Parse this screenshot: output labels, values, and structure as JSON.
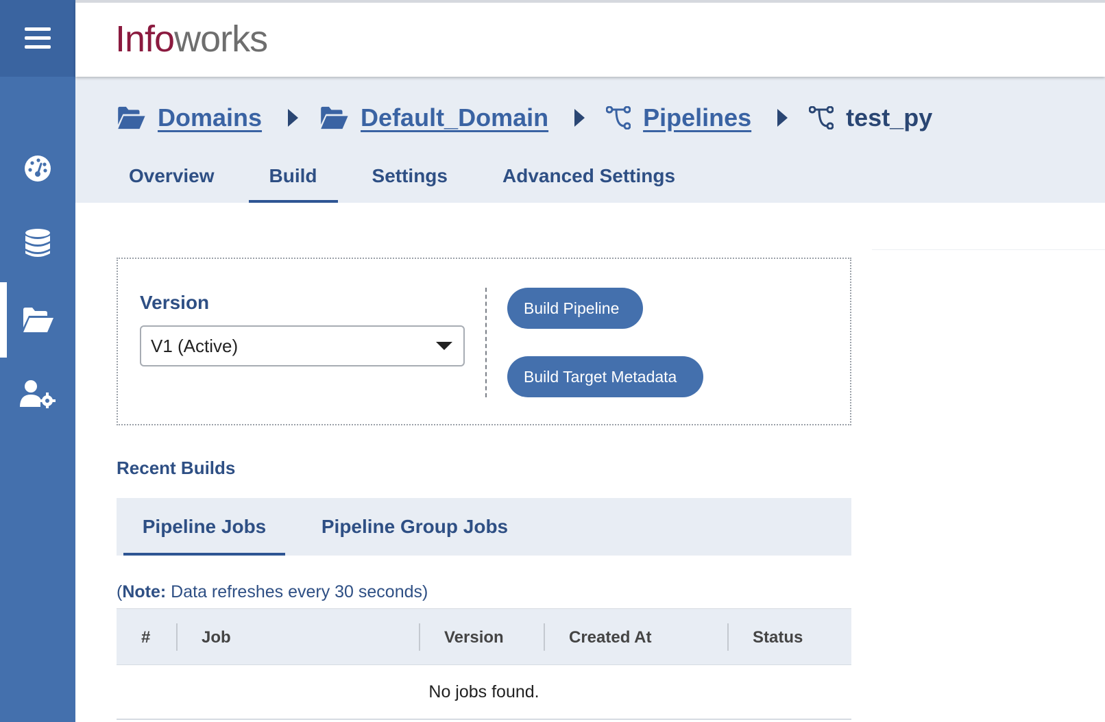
{
  "app": {
    "logo_part1": "Info",
    "logo_part2": "works"
  },
  "sidebar": {
    "items": [
      {
        "icon": "dashboard-gauge-icon"
      },
      {
        "icon": "database-icon"
      },
      {
        "icon": "folder-open-icon",
        "active": true
      },
      {
        "icon": "user-settings-icon"
      }
    ]
  },
  "breadcrumb": {
    "items": [
      {
        "label": "Domains",
        "icon": "folder-open-icon"
      },
      {
        "label": "Default_Domain",
        "icon": "folder-open-icon"
      },
      {
        "label": "Pipelines",
        "icon": "pipeline-icon"
      }
    ],
    "current": {
      "label": "test_py",
      "icon": "pipeline-icon"
    }
  },
  "tabs": [
    {
      "label": "Overview"
    },
    {
      "label": "Build",
      "active": true
    },
    {
      "label": "Settings"
    },
    {
      "label": "Advanced Settings"
    }
  ],
  "version": {
    "label": "Version",
    "selected": "V1 (Active)"
  },
  "actions": {
    "build_pipeline": "Build Pipeline",
    "build_target_metadata": "Build Target Metadata"
  },
  "recent_builds": {
    "title": "Recent Builds",
    "subtabs": [
      {
        "label": "Pipeline Jobs",
        "active": true
      },
      {
        "label": "Pipeline Group Jobs"
      }
    ],
    "note_prefix": "(",
    "note_bold": "Note:",
    "note_text": " Data refreshes every 30 seconds)",
    "table": {
      "columns": [
        "#",
        "Job",
        "Version",
        "Created At",
        "Status"
      ],
      "empty_message": "No jobs found."
    }
  },
  "colors": {
    "sidebar": "#4470ad",
    "accent": "#2e4f84",
    "logo_primary": "#8b1a3f",
    "logo_secondary": "#6e6e6e"
  }
}
